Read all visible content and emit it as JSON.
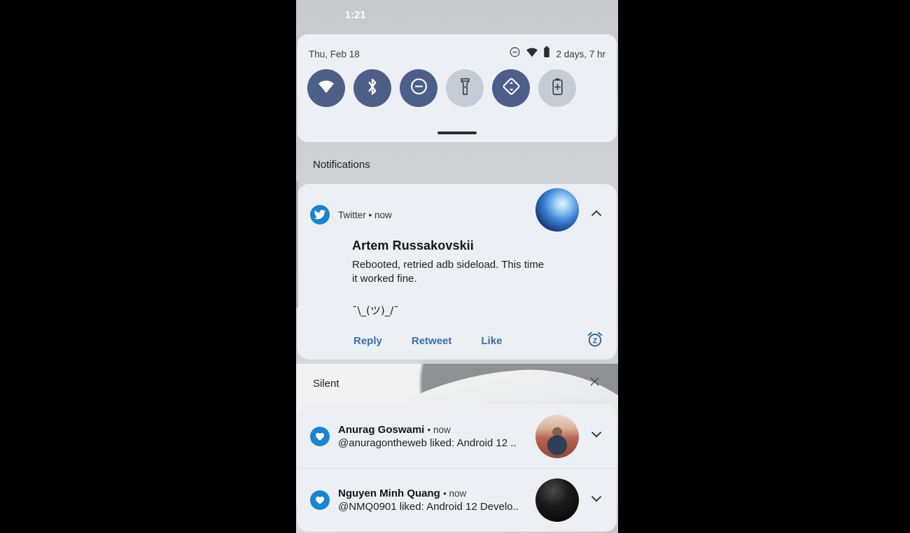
{
  "statusbar": {
    "clock": "1:21"
  },
  "quick_settings": {
    "date": "Thu, Feb 18",
    "battery_text": "2 days, 7 hr",
    "status_icons": [
      "dnd-icon",
      "wifi-icon",
      "battery-icon"
    ],
    "tiles": [
      {
        "name": "wifi",
        "icon": "wifi-icon",
        "state": "on"
      },
      {
        "name": "bluetooth",
        "icon": "bluetooth-icon",
        "state": "on"
      },
      {
        "name": "dnd",
        "icon": "dnd-icon",
        "state": "on"
      },
      {
        "name": "flashlight",
        "icon": "flashlight-icon",
        "state": "off"
      },
      {
        "name": "auto-rotate",
        "icon": "auto-rotate-icon",
        "state": "on"
      },
      {
        "name": "battery-saver",
        "icon": "battery-saver-icon",
        "state": "off"
      }
    ],
    "handle": "drag-handle"
  },
  "sections": {
    "notifications_title": "Notifications",
    "silent_title": "Silent",
    "silent_clear_icon": "close-icon"
  },
  "twitter_notification": {
    "app_badge_icon": "twitter-icon",
    "app_meta": "Twitter • now",
    "app_name": "Twitter",
    "timestamp": "now",
    "expand_icon": "chevron-up-icon",
    "avatar": "avatar-blue-abstract",
    "title": "Artem Russakovskii",
    "body": "Rebooted, retried adb sideload. This time it worked fine.",
    "extra": "¯\\_(ツ)_/¯",
    "actions": [
      "Reply",
      "Retweet",
      "Like"
    ],
    "snooze_icon": "snooze-alarm-icon"
  },
  "silent_notifications": [
    {
      "badge_icon": "heart-icon",
      "name": "Anurag Goswami",
      "timestamp": "• now",
      "subtitle": "@anuragontheweb liked: Android 12 ..",
      "avatar": "avatar-person",
      "expand_icon": "chevron-down-icon"
    },
    {
      "badge_icon": "heart-icon",
      "name": "Nguyen Minh Quang",
      "timestamp": "• now",
      "subtitle": "@NMQ0901 liked: Android 12 Develo..",
      "avatar": "avatar-dark",
      "expand_icon": "chevron-down-icon"
    }
  ],
  "colors": {
    "tile_on": "#4d5e88",
    "tile_off": "#c6ccd7",
    "card_bg": "#eceff4",
    "twitter_blue": "#1b84ce",
    "action_blue": "#3b6ea5"
  }
}
